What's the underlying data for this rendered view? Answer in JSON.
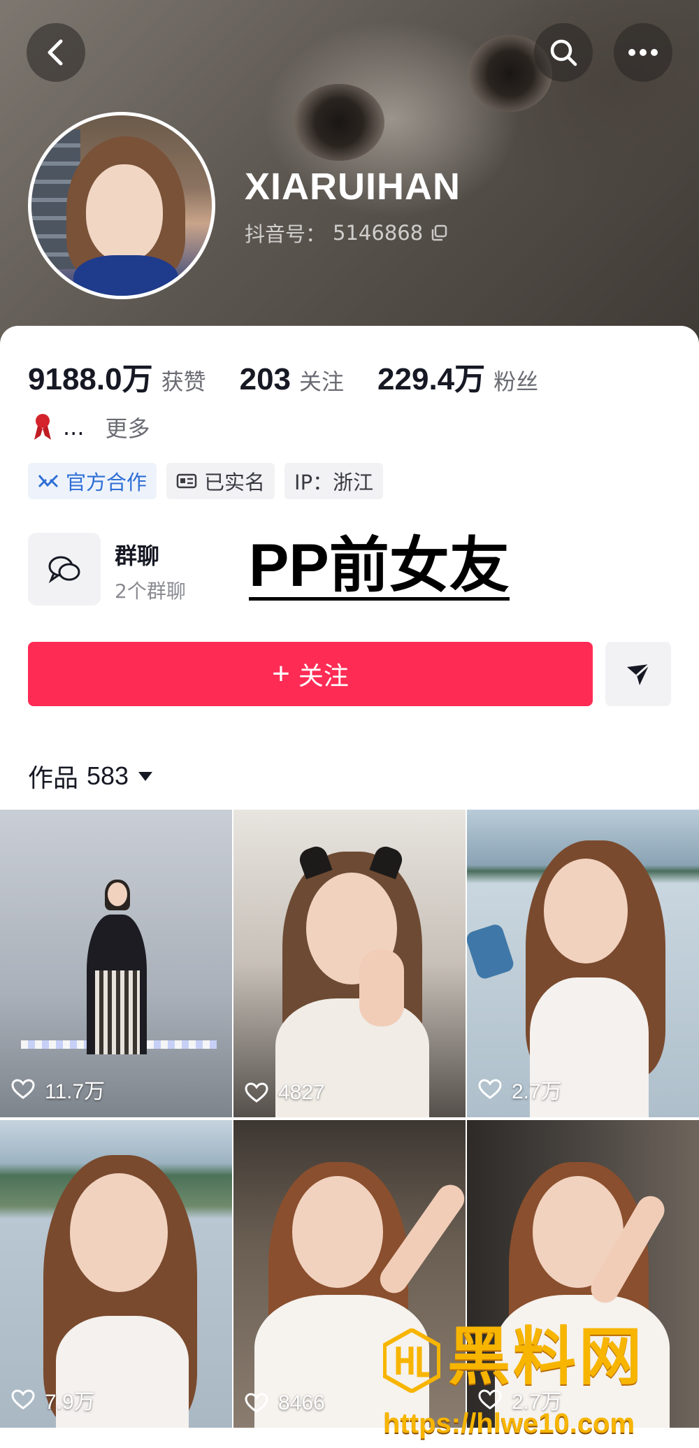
{
  "header": {
    "back_icon": "chevron-left-icon",
    "search_icon": "search-icon",
    "more_icon": "more-horizontal-icon"
  },
  "profile": {
    "username": "XIARUIHAN",
    "douyin_id_label": "抖音号：",
    "douyin_id": "5146868"
  },
  "stats": [
    {
      "value": "9188.0万",
      "label": "获赞"
    },
    {
      "value": "203",
      "label": "关注"
    },
    {
      "value": "229.4万",
      "label": "粉丝"
    }
  ],
  "bio": {
    "emoji": "ribbon-icon",
    "text": "...",
    "more": "更多"
  },
  "tags": {
    "official": "官方合作",
    "verified": "已实名",
    "ip": "IP：浙江"
  },
  "group_chat": {
    "title": "群聊",
    "subtitle": "2个群聊"
  },
  "overlay_text": "PP前女友",
  "actions": {
    "follow": "关注",
    "follow_plus": "+"
  },
  "works": {
    "label": "作品",
    "count": "583"
  },
  "videos": [
    {
      "likes": "11.7万"
    },
    {
      "likes": "4827"
    },
    {
      "likes": "2.7万"
    },
    {
      "likes": "7.9万"
    },
    {
      "likes": "8466"
    },
    {
      "likes": "2.7万"
    }
  ],
  "watermark": {
    "title": "黑料网",
    "url": "https://hlwe10.com"
  },
  "colors": {
    "accent": "#fe2c55",
    "blue_tag": "#2f6fd6",
    "watermark": "#f7b500"
  }
}
